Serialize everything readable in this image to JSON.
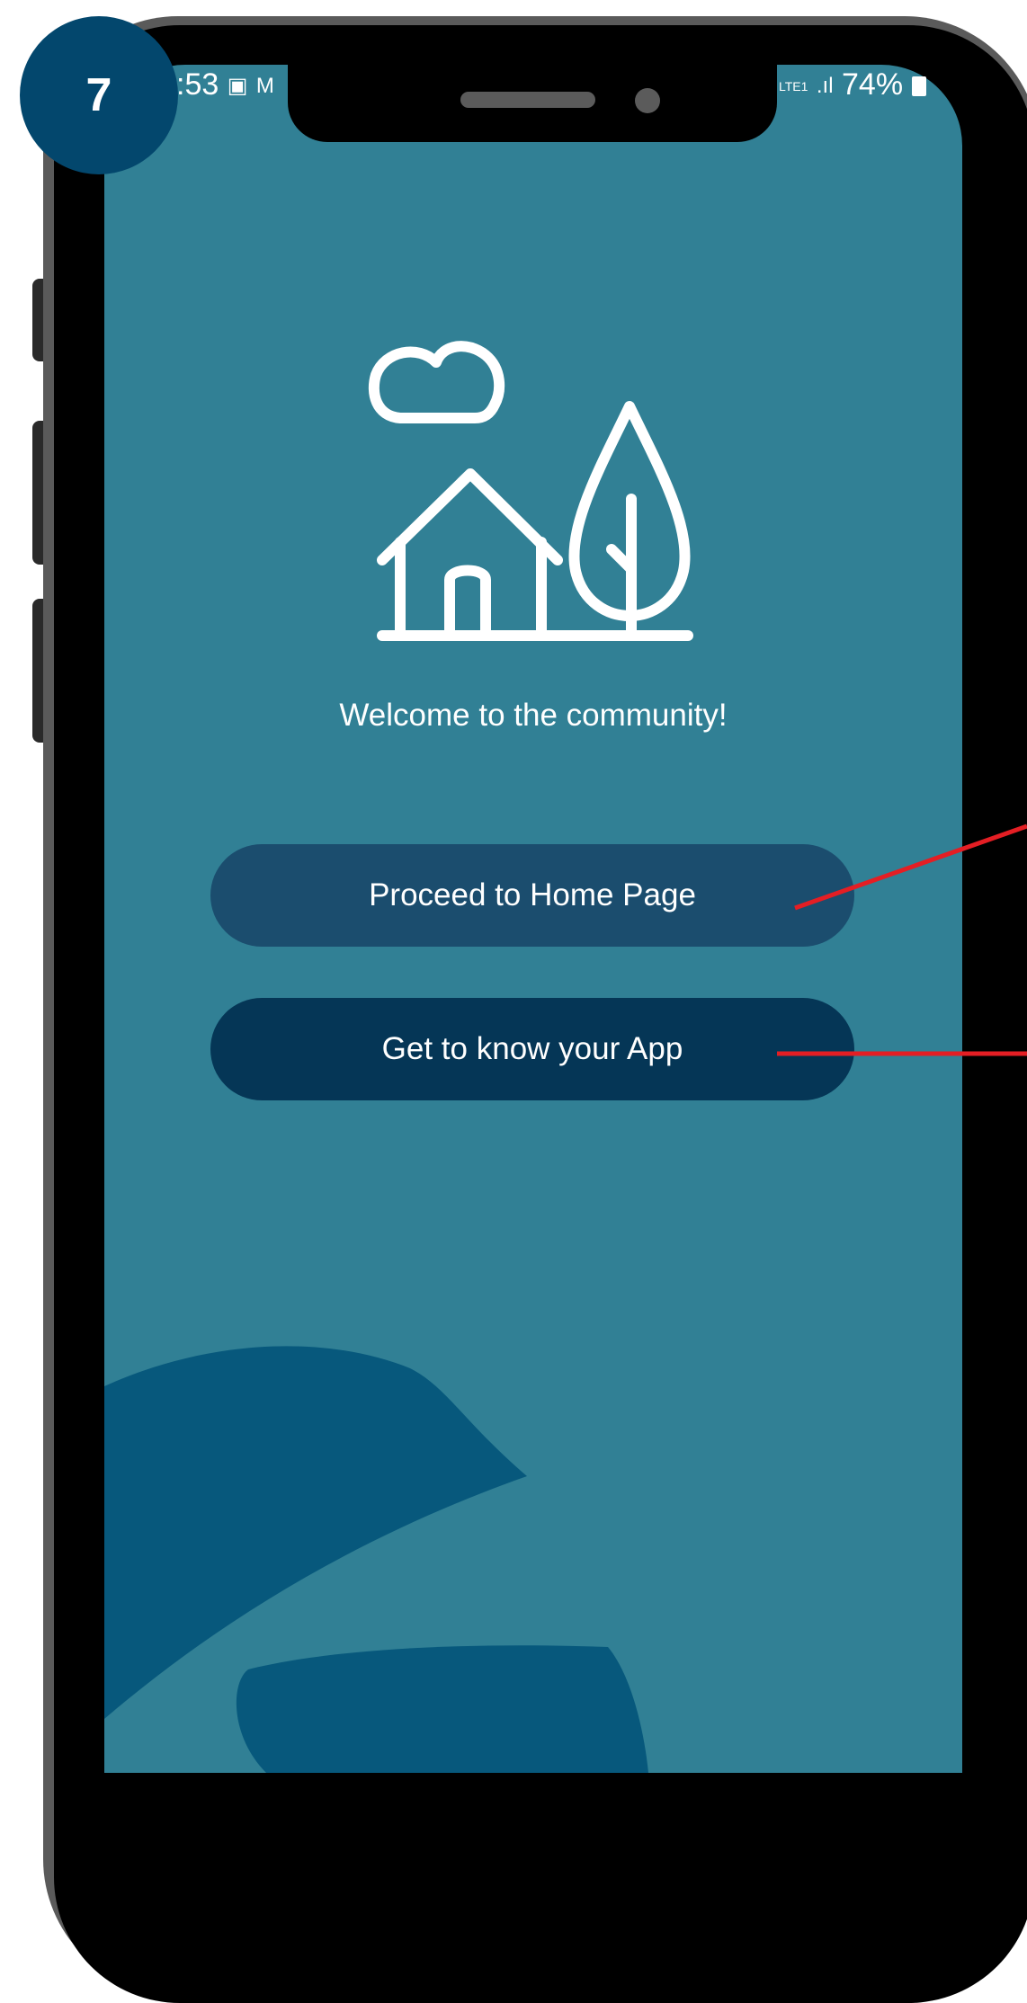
{
  "step_badge": {
    "number": "7"
  },
  "status_bar": {
    "time": ":53",
    "left_icons": [
      "teams-icon",
      "gmail-icon"
    ],
    "right_network": "LTE1",
    "battery": "74%"
  },
  "illustration": {
    "icon": "house-tree-cloud-icon"
  },
  "welcome": {
    "text": "Welcome to the community!"
  },
  "buttons": {
    "proceed": "Proceed to Home Page",
    "tour": "Get to know your App"
  },
  "colors": {
    "screen_bg": "#318095",
    "primary_button": "#1b4d6e",
    "secondary_button": "#053656",
    "badge": "#03476d",
    "callout_line": "#e41e24"
  }
}
